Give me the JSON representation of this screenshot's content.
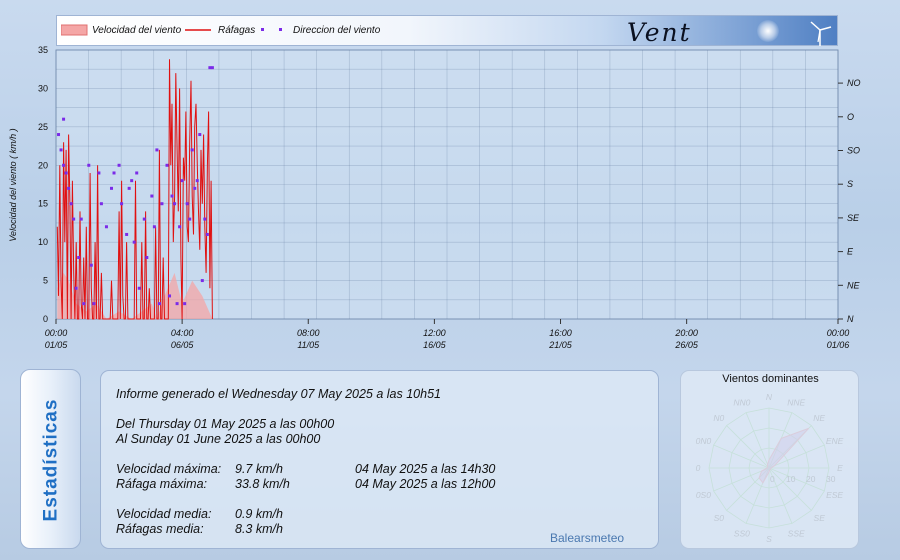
{
  "header": {
    "title": "Vent",
    "legend": [
      {
        "label": "Velocidad del viento",
        "swatch": "area"
      },
      {
        "label": "Ráfagas",
        "swatch": "line"
      },
      {
        "label": "Direccion del viento",
        "swatch": "dots"
      }
    ]
  },
  "colors": {
    "speed_fill": "#f4a6a6",
    "gust_line": "#e01010",
    "direction_dots": "#7b2be8",
    "title_text": "#1f6fc4",
    "rose_grid": "#3fae3f",
    "rose_fill": "#8a3aa8"
  },
  "chart_data": [
    {
      "type": "line",
      "ylabel": "Velocidad del viento ( km/h )",
      "ylim": [
        0,
        35
      ],
      "yticks": [
        0,
        5,
        10,
        15,
        20,
        25,
        30,
        35
      ],
      "xlim_days": [
        0,
        31
      ],
      "xticks": [
        {
          "day": 0,
          "time": "00:00",
          "date": "01/05"
        },
        {
          "day": 5,
          "time": "04:00",
          "date": "06/05"
        },
        {
          "day": 10,
          "time": "08:00",
          "date": "11/05"
        },
        {
          "day": 15,
          "time": "12:00",
          "date": "16/05"
        },
        {
          "day": 20,
          "time": "16:00",
          "date": "21/05"
        },
        {
          "day": 25,
          "time": "20:00",
          "date": "26/05"
        },
        {
          "day": 31,
          "time": "00:00",
          "date": "01/06"
        }
      ],
      "y2_labels": [
        "N",
        "NE",
        "E",
        "SE",
        "S",
        "SO",
        "O",
        "NO"
      ],
      "grid": true,
      "series": [
        {
          "name": "Ráfagas",
          "kind": "line",
          "x": [
            0.05,
            0.1,
            0.15,
            0.2,
            0.25,
            0.3,
            0.35,
            0.4,
            0.45,
            0.5,
            0.55,
            0.6,
            0.65,
            0.7,
            0.75,
            0.8,
            0.85,
            0.9,
            0.95,
            1.0,
            1.05,
            1.1,
            1.15,
            1.2,
            1.25,
            1.3,
            1.35,
            1.4,
            1.45,
            1.5,
            1.55,
            1.6,
            1.65,
            1.7,
            1.75,
            1.8,
            1.85,
            1.9,
            1.95,
            2.0,
            2.05,
            2.1,
            2.15,
            2.2,
            2.25,
            2.3,
            2.35,
            2.4,
            2.45,
            2.5,
            2.55,
            2.6,
            2.65,
            2.7,
            2.75,
            2.8,
            2.85,
            2.9,
            2.95,
            3.0,
            3.05,
            3.1,
            3.15,
            3.2,
            3.25,
            3.3,
            3.35,
            3.4,
            3.45,
            3.5,
            3.55,
            3.6,
            3.65,
            3.7,
            3.75,
            3.8,
            3.85,
            3.9,
            3.95,
            4.0,
            4.05,
            4.1,
            4.15,
            4.2,
            4.25,
            4.3,
            4.35,
            4.4,
            4.45,
            4.5,
            4.55,
            4.6,
            4.65,
            4.7,
            4.75,
            4.8,
            4.85,
            4.9,
            4.95,
            5.0,
            5.05,
            5.1,
            5.15,
            5.2,
            5.25,
            5.3,
            5.35,
            5.4,
            5.45,
            5.5,
            5.55,
            5.6,
            5.65,
            5.7,
            5.75,
            5.8,
            5.85,
            5.9,
            5.95,
            6.0,
            6.05,
            6.1,
            6.15,
            6.2
          ],
          "values": [
            12,
            3,
            20,
            5,
            0,
            23,
            10,
            22,
            0,
            24,
            15,
            0,
            18,
            6,
            0,
            10,
            0,
            0,
            14,
            2,
            0,
            8,
            0,
            12,
            0,
            0,
            19,
            4,
            0,
            0,
            10,
            0,
            20,
            0,
            0,
            6,
            0,
            0,
            0,
            0,
            0,
            0,
            0,
            5,
            0,
            0,
            0,
            0,
            0,
            14,
            0,
            18,
            3,
            0,
            0,
            10,
            0,
            0,
            0,
            0,
            0,
            0,
            18,
            0,
            0,
            0,
            0,
            10,
            0,
            0,
            14,
            0,
            0,
            4,
            0,
            0,
            0,
            0,
            12,
            0,
            0,
            22,
            0,
            0,
            8,
            0,
            0,
            0,
            0,
            33.8,
            20,
            28,
            10,
            16,
            32,
            22,
            14,
            30,
            8,
            0,
            21,
            18,
            27,
            12,
            10,
            23,
            31,
            16,
            11,
            25,
            28,
            20,
            14,
            9,
            22,
            15,
            24,
            12,
            6,
            20,
            27,
            4,
            18,
            0
          ]
        },
        {
          "name": "Velocidad del viento",
          "kind": "area",
          "x": [
            0.05,
            0.3,
            0.5,
            0.8,
            1.2,
            1.6,
            2.0,
            2.5,
            3.0,
            3.4,
            3.8,
            4.0,
            4.3,
            4.7,
            5.0,
            5.4,
            5.8,
            6.2
          ],
          "values": [
            4,
            6,
            5,
            2,
            1,
            2,
            0,
            1,
            0,
            1,
            2,
            0,
            3,
            6,
            2,
            5,
            3,
            0
          ]
        },
        {
          "name": "Direccion del viento",
          "kind": "dots",
          "x": [
            0.1,
            0.2,
            0.3,
            0.3,
            0.4,
            0.5,
            0.6,
            0.7,
            0.8,
            0.9,
            1.0,
            1.1,
            1.3,
            1.4,
            1.5,
            1.7,
            1.8,
            2.0,
            2.2,
            2.3,
            2.5,
            2.6,
            2.8,
            3.0,
            3.2,
            3.3,
            3.5,
            3.6,
            3.8,
            3.9,
            4.0,
            4.1,
            4.2,
            4.4,
            4.5,
            4.6,
            4.7,
            4.8,
            4.9,
            5.0,
            5.1,
            5.2,
            5.3,
            5.4,
            5.5,
            5.6,
            5.8,
            5.9,
            6.0,
            6.1,
            6.2,
            3.1,
            2.9,
            5.7
          ],
          "values": [
            24,
            22,
            20,
            26,
            19,
            17,
            15,
            13,
            4,
            8,
            13,
            2,
            20,
            7,
            2,
            19,
            15,
            12,
            17,
            19,
            20,
            15,
            11,
            18,
            19,
            4,
            13,
            8,
            16,
            12,
            22,
            2,
            15,
            20,
            3,
            16,
            15,
            2,
            12,
            18,
            2,
            15,
            13,
            22,
            17,
            18,
            5,
            13,
            11,
            32.7,
            32.7,
            10,
            17,
            24
          ]
        }
      ]
    },
    {
      "type": "radar",
      "title": "Vientos dominantes",
      "directions": [
        "N",
        "NNE",
        "NE",
        "ENE",
        "E",
        "ESE",
        "SE",
        "SSE",
        "S",
        "SS0",
        "S0",
        "0S0",
        "0",
        "0N0",
        "N0",
        "NN0"
      ],
      "rlim": [
        0,
        30
      ],
      "rticks": [
        0,
        10,
        20,
        30
      ],
      "values": [
        4,
        16,
        28,
        3,
        1,
        1,
        1,
        1,
        2,
        8,
        7,
        4,
        1,
        1,
        1,
        2
      ]
    }
  ],
  "report": {
    "generated": "Informe generado el Wednesday 07 May 2025 a las 10h51",
    "from": "Del Thursday 01 May 2025 a las 00h00",
    "to": "Al Sunday 01 June 2025 a las 00h00",
    "max_speed_label": "Velocidad máxima:",
    "max_speed_value": "9.7 km/h",
    "max_speed_when": "04 May 2025 a las 14h30",
    "max_gust_label": "Ráfaga máxima:",
    "max_gust_value": "33.8 km/h",
    "max_gust_when": "04 May 2025 a las 12h00",
    "avg_speed_label": "Velocidad media:",
    "avg_speed_value": "0.9 km/h",
    "avg_gust_label": "Ráfagas media:",
    "avg_gust_value": "8.3 km/h",
    "credit": "Balearsmeteo"
  },
  "sidebar": {
    "label": "Estadísticas"
  }
}
